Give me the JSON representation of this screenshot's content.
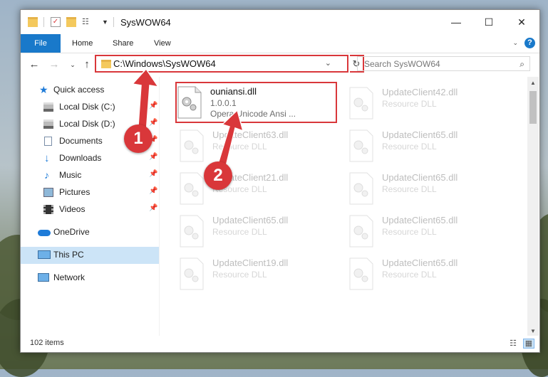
{
  "window": {
    "title": "SysWOW64",
    "controls": {
      "minimize": "—",
      "maximize": "☐",
      "close": "✕"
    }
  },
  "ribbon": {
    "tabs": [
      "File",
      "Home",
      "Share",
      "View"
    ],
    "help": "?"
  },
  "address": {
    "path": "C:\\Windows\\SysWOW64",
    "search_placeholder": "Search SysWOW64"
  },
  "sidebar": {
    "items": [
      {
        "label": "Quick access",
        "icon": "star-icon",
        "pinned": false
      },
      {
        "label": "Local Disk (C:)",
        "icon": "drive-icon",
        "pinned": true
      },
      {
        "label": "Local Disk (D:)",
        "icon": "drive-icon",
        "pinned": true
      },
      {
        "label": "Documents",
        "icon": "documents-icon",
        "pinned": true
      },
      {
        "label": "Downloads",
        "icon": "download-icon",
        "pinned": true
      },
      {
        "label": "Music",
        "icon": "music-icon",
        "pinned": true
      },
      {
        "label": "Pictures",
        "icon": "pictures-icon",
        "pinned": true
      },
      {
        "label": "Videos",
        "icon": "videos-icon",
        "pinned": true
      },
      {
        "label": "OneDrive",
        "icon": "cloud-icon",
        "pinned": false
      },
      {
        "label": "This PC",
        "icon": "computer-icon",
        "pinned": false,
        "selected": true
      },
      {
        "label": "Network",
        "icon": "network-icon",
        "pinned": false
      }
    ]
  },
  "files": {
    "left": [
      {
        "name": "ouniansi.dll",
        "version": "1.0.0.1",
        "description": "Opera Unicode Ansi ...",
        "highlighted": true
      },
      {
        "name": "UpdateClient63.dll",
        "version": "",
        "description": "Resource DLL"
      },
      {
        "name": "UpdateClient21.dll",
        "version": "",
        "description": "Resource DLL"
      },
      {
        "name": "UpdateClient65.dll",
        "version": "",
        "description": "Resource DLL"
      },
      {
        "name": "UpdateClient19.dll",
        "version": "",
        "description": "Resource DLL"
      }
    ],
    "right": [
      {
        "name": "UpdateClient42.dll",
        "version": "",
        "description": "Resource DLL"
      },
      {
        "name": "UpdateClient65.dll",
        "version": "",
        "description": "Resource DLL"
      },
      {
        "name": "UpdateClient65.dll",
        "version": "",
        "description": "Resource DLL"
      },
      {
        "name": "UpdateClient65.dll",
        "version": "",
        "description": "Resource DLL"
      },
      {
        "name": "UpdateClient65.dll",
        "version": "",
        "description": "Resource DLL"
      }
    ]
  },
  "status": {
    "item_count": "102 items"
  },
  "callouts": {
    "one": "1",
    "two": "2"
  },
  "colors": {
    "accent": "#1979ca",
    "callout": "#d9373a",
    "selection": "#cce4f7"
  }
}
